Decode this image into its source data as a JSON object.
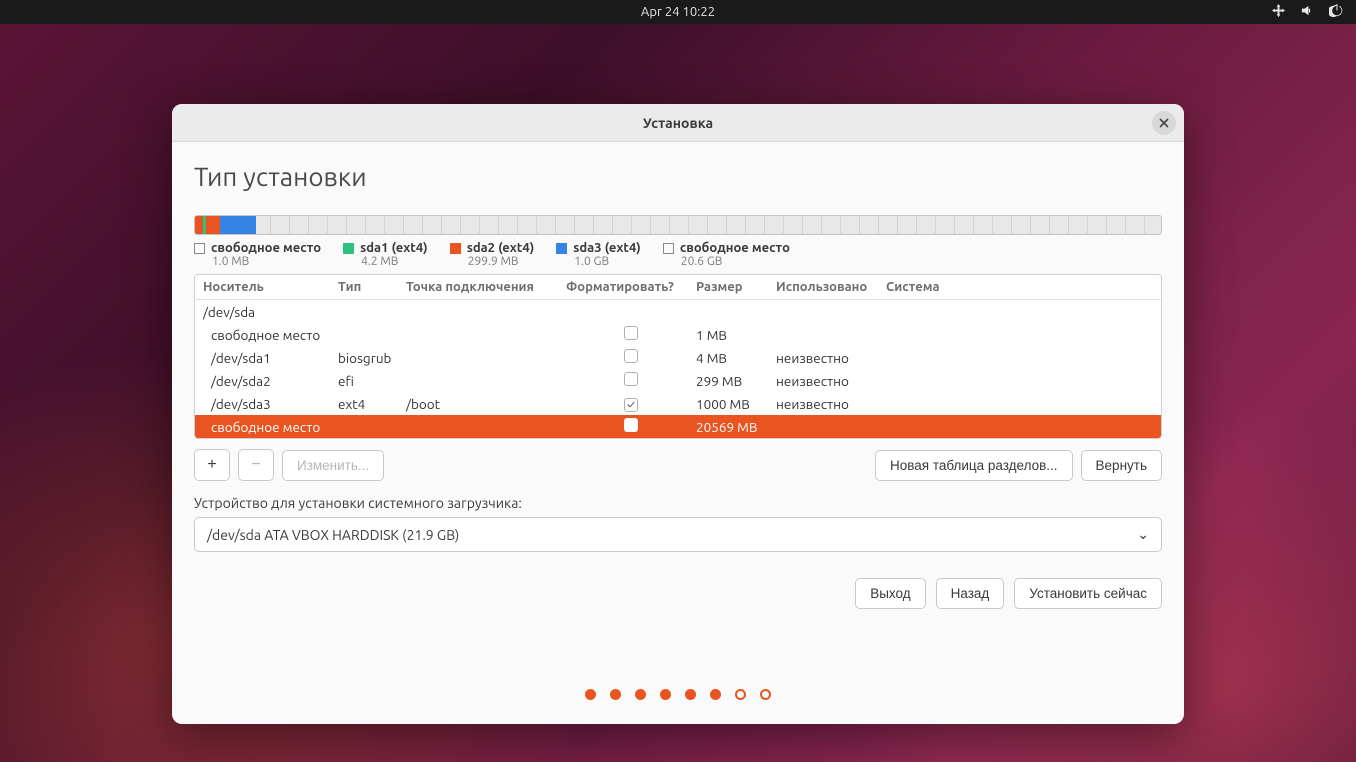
{
  "topbar": {
    "datetime": "Apr 24  10:22"
  },
  "window": {
    "title": "Установка",
    "heading": "Тип установки"
  },
  "legend": [
    {
      "swatch": "empty",
      "label": "свободное место",
      "sub": "1.0 MB"
    },
    {
      "swatch": "green",
      "label": "sda1 (ext4)",
      "sub": "4.2 MB"
    },
    {
      "swatch": "orange",
      "label": "sda2 (ext4)",
      "sub": "299.9 MB"
    },
    {
      "swatch": "blue",
      "label": "sda3 (ext4)",
      "sub": "1.0 GB"
    },
    {
      "swatch": "empty",
      "label": "свободное место",
      "sub": "20.6 GB"
    }
  ],
  "table": {
    "headers": {
      "device": "Носитель",
      "type": "Тип",
      "mount": "Точка подключения",
      "format": "Форматировать?",
      "size": "Размер",
      "used": "Использовано",
      "system": "Система"
    },
    "disk": "/dev/sda",
    "rows": [
      {
        "indent": true,
        "device": "свободное место",
        "type": "",
        "mount": "",
        "format": "unchecked",
        "size": "1 MB",
        "used": "",
        "system": ""
      },
      {
        "indent": true,
        "device": "/dev/sda1",
        "type": "biosgrub",
        "mount": "",
        "format": "unchecked",
        "size": "4 MB",
        "used": "неизвестно",
        "system": ""
      },
      {
        "indent": true,
        "device": "/dev/sda2",
        "type": "efi",
        "mount": "",
        "format": "unchecked",
        "size": "299 MB",
        "used": "неизвестно",
        "system": ""
      },
      {
        "indent": true,
        "device": "/dev/sda3",
        "type": "ext4",
        "mount": "/boot",
        "format": "checked",
        "size": "1000 MB",
        "used": "неизвестно",
        "system": ""
      },
      {
        "indent": true,
        "selected": true,
        "device": "свободное место",
        "type": "",
        "mount": "",
        "format": "unchecked",
        "size": "20569 MB",
        "used": "",
        "system": ""
      }
    ]
  },
  "toolbar": {
    "add": "+",
    "remove": "−",
    "change": "Изменить...",
    "new_table": "Новая таблица разделов...",
    "revert": "Вернуть"
  },
  "bootloader": {
    "label": "Устройство для установки системного загрузчика:",
    "value": "/dev/sda   ATA VBOX HARDDISK (21.9 GB)"
  },
  "nav": {
    "quit": "Выход",
    "back": "Назад",
    "install": "Установить сейчас"
  },
  "progress": {
    "total": 8,
    "current": 6
  }
}
